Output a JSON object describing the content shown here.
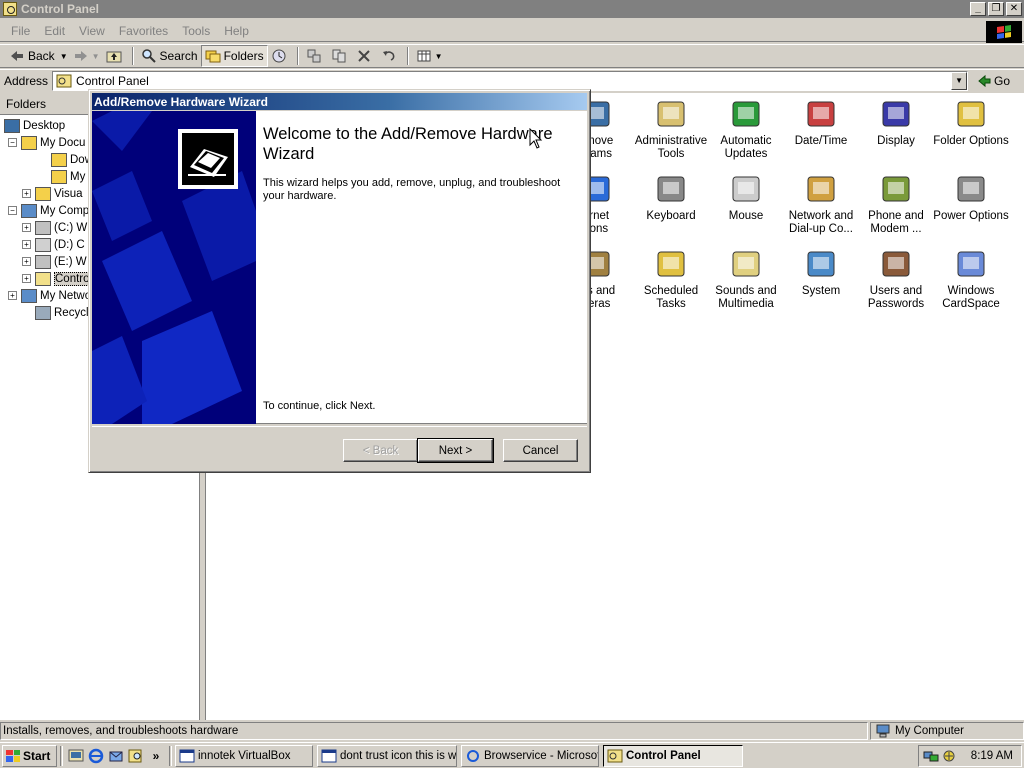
{
  "window": {
    "title": "Control Panel",
    "controls": {
      "minimize": "_",
      "restore": "❐",
      "close": "✕"
    }
  },
  "menubar": {
    "items": [
      "File",
      "Edit",
      "View",
      "Favorites",
      "Tools",
      "Help"
    ]
  },
  "toolbar": {
    "back_label": "Back",
    "search_label": "Search",
    "folders_label": "Folders"
  },
  "address": {
    "label": "Address",
    "value": "Control Panel",
    "go_label": "Go"
  },
  "folders_pane": {
    "header": "Folders",
    "tree": [
      {
        "label": "Desktop",
        "icon": "desktop-icon"
      },
      {
        "label": "My Docu",
        "icon": "my-documents-icon",
        "expander": "−"
      },
      {
        "label": "Down",
        "icon": "folder-icon"
      },
      {
        "label": "My Pi",
        "icon": "my-pictures-icon"
      },
      {
        "label": "Visua",
        "icon": "folder-icon",
        "expander": "+"
      },
      {
        "label": "My Compu",
        "icon": "my-computer-icon",
        "expander": "−"
      },
      {
        "label": "(C:) W",
        "icon": "drive-icon",
        "expander": "+"
      },
      {
        "label": "(D:) C",
        "icon": "cd-drive-icon",
        "expander": "+"
      },
      {
        "label": "(E:) W",
        "icon": "drive-icon",
        "expander": "+"
      },
      {
        "label": "Contro",
        "icon": "control-panel-icon",
        "expander": "+"
      },
      {
        "label": "My Netwo",
        "icon": "my-network-icon",
        "expander": "+"
      },
      {
        "label": "Recycle B",
        "icon": "recycle-bin-icon"
      }
    ]
  },
  "control_panel": {
    "items": [
      {
        "label": "emove\ngrams",
        "icon": "add-remove-programs-icon"
      },
      {
        "label": "Administrative\nTools",
        "icon": "administrative-tools-icon"
      },
      {
        "label": "Automatic\nUpdates",
        "icon": "automatic-updates-icon"
      },
      {
        "label": "Date/Time",
        "icon": "date-time-icon"
      },
      {
        "label": "Display",
        "icon": "display-icon"
      },
      {
        "label": "Folder Options",
        "icon": "folder-options-icon"
      },
      {
        "label": "ernet\ntions",
        "icon": "internet-options-icon"
      },
      {
        "label": "Keyboard",
        "icon": "keyboard-icon"
      },
      {
        "label": "Mouse",
        "icon": "mouse-icon"
      },
      {
        "label": "Network and\nDial-up Co...",
        "icon": "network-icon"
      },
      {
        "label": "Phone and\nModem ...",
        "icon": "phone-modem-icon"
      },
      {
        "label": "Power Options",
        "icon": "power-options-icon"
      },
      {
        "label": "ers and\nneras",
        "icon": "scanners-cameras-icon"
      },
      {
        "label": "Scheduled\nTasks",
        "icon": "scheduled-tasks-icon"
      },
      {
        "label": "Sounds and\nMultimedia",
        "icon": "sounds-icon"
      },
      {
        "label": "System",
        "icon": "system-icon"
      },
      {
        "label": "Users and\nPasswords",
        "icon": "users-icon"
      },
      {
        "label": "Windows\nCardSpace",
        "icon": "cardspace-icon"
      }
    ]
  },
  "statusbar": {
    "text": "Installs, removes, and troubleshoots hardware",
    "zone": "My Computer"
  },
  "taskbar": {
    "start_label": "Start",
    "tasks": [
      {
        "label": "innotek VirtualBox",
        "active": false
      },
      {
        "label": "dont trust icon this is w...",
        "active": false
      },
      {
        "label": "Browservice - Microsof...",
        "active": false
      },
      {
        "label": "Control Panel",
        "active": true
      }
    ],
    "more_label": "»",
    "clock": "8:19 AM"
  },
  "wizard": {
    "title": "Add/Remove Hardware Wizard",
    "heading": "Welcome to the Add/Remove Hardware Wizard",
    "description": "This wizard helps you add, remove, unplug, and troubleshoot your hardware.",
    "continue_text": "To continue, click Next.",
    "back_label": "< Back",
    "next_label": "Next >",
    "cancel_label": "Cancel"
  },
  "colors": {
    "titlebar_inactive": "#808080",
    "dialog_title_start": "#0a246a",
    "dialog_title_end": "#a6caf0",
    "wizard_side": "#00007a",
    "face": "#d4d0c8"
  }
}
